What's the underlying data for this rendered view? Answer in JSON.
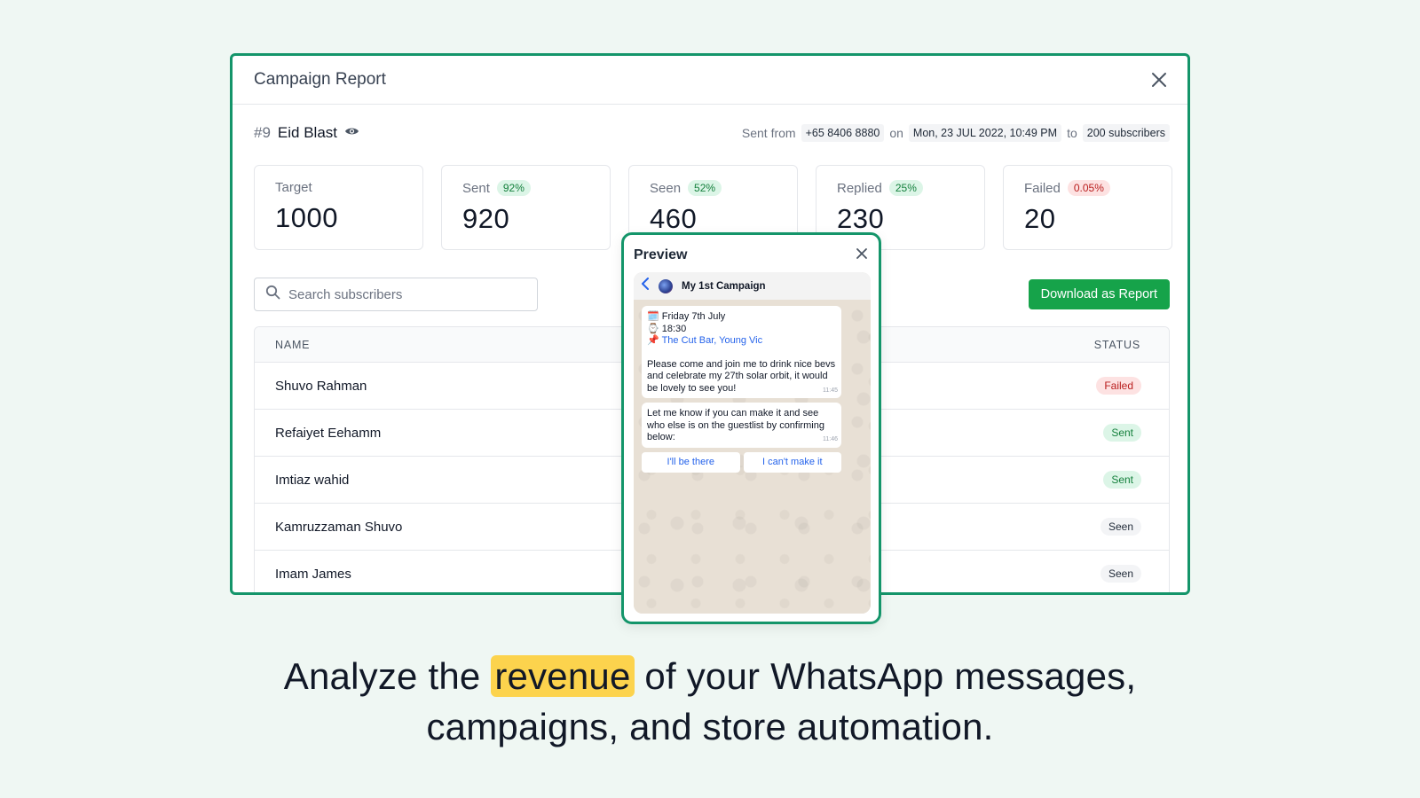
{
  "modal": {
    "title": "Campaign Report",
    "campaign_id": "#9",
    "campaign_name": "Eid Blast",
    "sent_from_label": "Sent from",
    "sender_number": "+65 8406 8880",
    "on_label": "on",
    "sent_date": "Mon, 23 JUL 2022, 10:49 PM",
    "to_label": "to",
    "recipients": "200 subscribers"
  },
  "stats": [
    {
      "label": "Target",
      "value": "1000",
      "badge": ""
    },
    {
      "label": "Sent",
      "value": "920",
      "badge": "92%"
    },
    {
      "label": "Seen",
      "value": "460",
      "badge": "52%"
    },
    {
      "label": "Replied",
      "value": "230",
      "badge": "25%"
    },
    {
      "label": "Failed",
      "value": "20",
      "badge": "0.05%"
    }
  ],
  "search": {
    "placeholder": "Search subscribers"
  },
  "download_label": "Download as Report",
  "table": {
    "col_name": "NAME",
    "col_status": "STATUS",
    "rows": [
      {
        "name": "Shuvo Rahman",
        "status": "Failed"
      },
      {
        "name": "Refaiyet Eehamm",
        "status": "Sent"
      },
      {
        "name": "Imtiaz wahid",
        "status": "Sent"
      },
      {
        "name": "Kamruzzaman Shuvo",
        "status": "Seen"
      },
      {
        "name": "Imam James",
        "status": "Seen"
      }
    ]
  },
  "preview": {
    "title": "Preview",
    "chat_name": "My 1st Campaign",
    "msg1": {
      "date_line": "🗓️ Friday 7th July",
      "time_line": "⌚ 18:30",
      "location_pin": "📌",
      "location": "The Cut Bar, Young Vic",
      "body": "Please come and join me to drink nice bevs and celebrate my 27th solar orbit, it would be lovely to see you!",
      "time": "11:45"
    },
    "msg2": {
      "body": "Let me know if you can make it and see who else is on the guestlist by confirming below:",
      "time": "11:46"
    },
    "reply_yes": "I'll be there",
    "reply_no": "I can't make it"
  },
  "tagline": {
    "before": "Analyze the",
    "highlight": "revenue",
    "after_line1": "of your WhatsApp messages,",
    "line2": "campaigns, and store automation."
  },
  "colors": {
    "brand_green": "#14956a",
    "button_green": "#16a34a",
    "highlight_yellow": "#fcd34d",
    "page_bg": "#eff7f3"
  }
}
